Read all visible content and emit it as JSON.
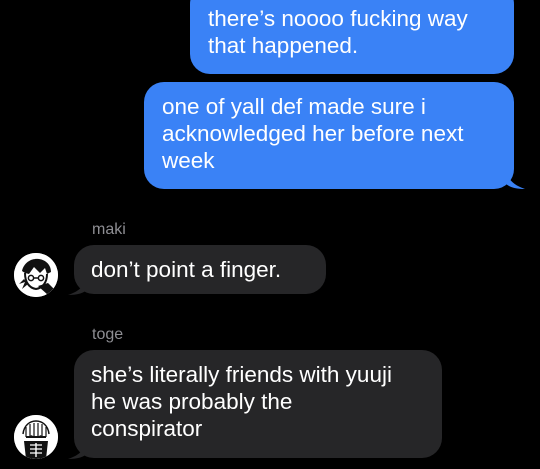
{
  "colors": {
    "background": "#000000",
    "outgoing_bubble": "#3a82f6",
    "incoming_bubble": "#262628",
    "sender_name": "#8e8e93"
  },
  "messages": [
    {
      "direction": "outgoing",
      "text": "there’s noooo fucking way\nthat happened."
    },
    {
      "direction": "outgoing",
      "text": "one of yall def made sure i\nacknowledged her before next\nweek"
    },
    {
      "direction": "incoming",
      "sender": "maki",
      "avatar_icon": "maki-avatar",
      "text": "don’t point a finger."
    },
    {
      "direction": "incoming",
      "sender": "toge",
      "avatar_icon": "toge-avatar",
      "text": "she’s literally friends with yuuji\nhe was probably the\nconspirator"
    }
  ]
}
